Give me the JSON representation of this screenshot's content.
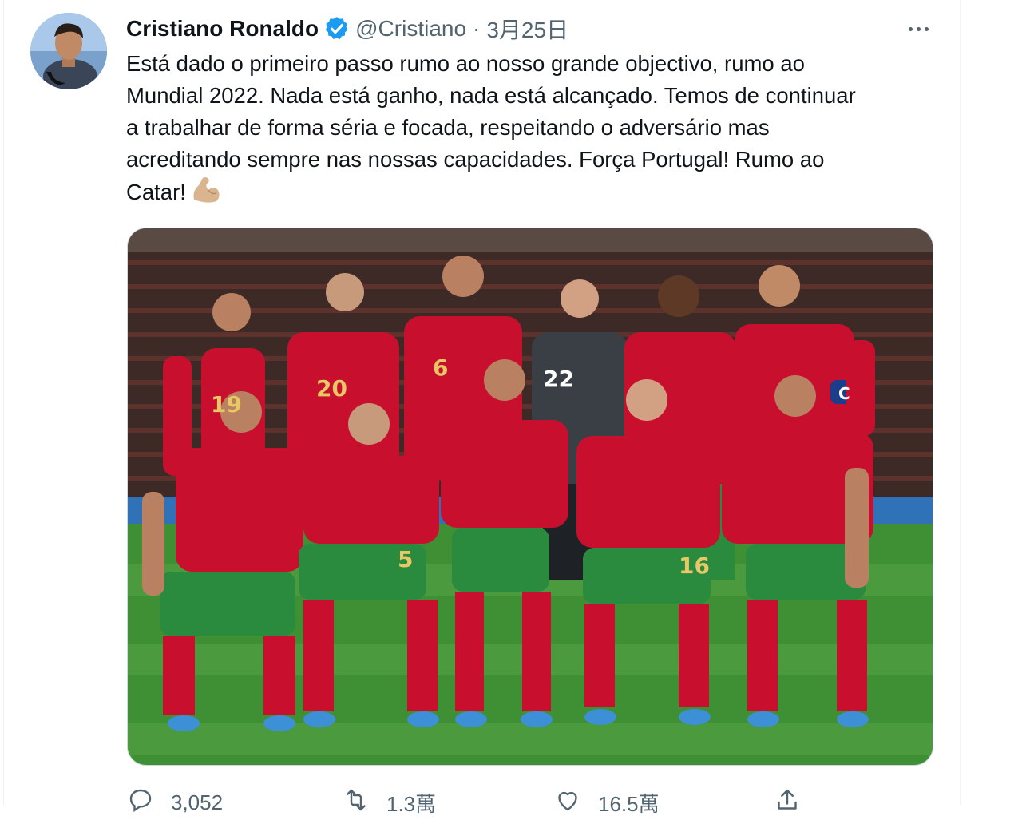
{
  "tweet": {
    "author_name": "Cristiano Ronaldo",
    "handle": "@Cristiano",
    "separator": "·",
    "date": "3月25日",
    "text": "Está dado o primeiro passo rumo ao nosso grande objectivo, rumo ao\nMundial 2022. Nada está ganho, nada está alcançado. Temos de continuar\na trabalhar de forma séria e focada, respeitando o adversário mas\nacreditando sempre nas nossas capacidades. Força Portugal! Rumo ao\nCatar!",
    "emoji_icon": "flexed-biceps-icon",
    "jersey_numbers": [
      "19",
      "20",
      "6",
      "22",
      "5",
      "16",
      "C"
    ]
  },
  "actions": {
    "reply_count": "3,052",
    "retweet_count": "1.3萬",
    "like_count": "16.5萬"
  },
  "colors": {
    "verified": "#1d9bf0",
    "text_secondary": "#536471",
    "jersey_red": "#c8102e",
    "shorts_green": "#2a8a3e",
    "pitch": "#3f8f34"
  }
}
